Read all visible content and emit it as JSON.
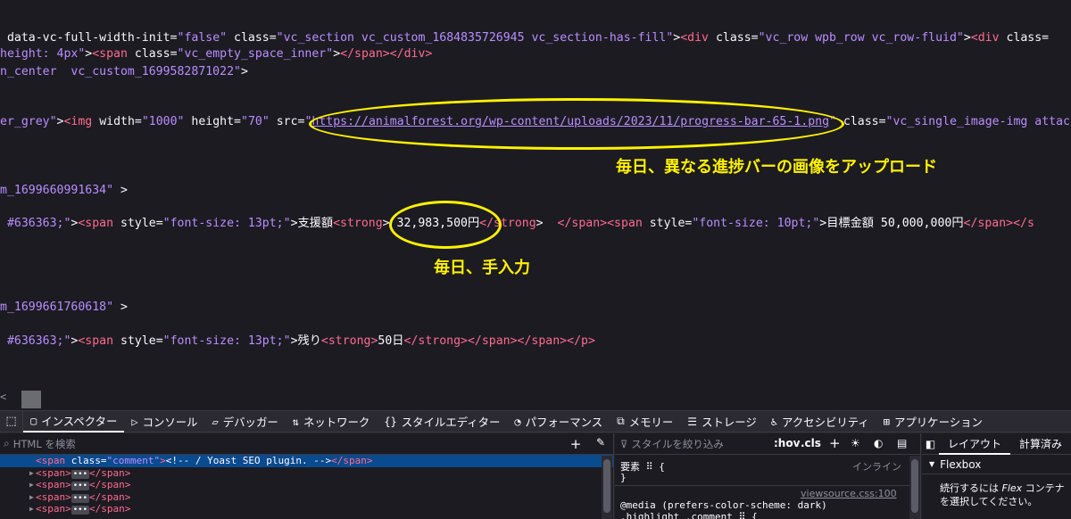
{
  "source": {
    "line1": {
      "p1": " data-vc-full-width-init=",
      "v1": "\"false\"",
      "a1": " class=",
      "v2": "\"vc_section vc_custom_1684835726945 vc_section-has-fill\"",
      "p2": ">",
      "t1": "<div",
      "a2": " class=",
      "v3": "\"vc_row wpb_row vc_row-fluid\"",
      "p3": ">",
      "t2": "<div",
      "a3": " class="
    },
    "line2": {
      "v1": "height: 4px\"",
      "p1": ">",
      "t1": "<span",
      "a1": " class=",
      "v2": "\"vc_empty_space_inner\"",
      "p2": ">",
      "t2": "</span>",
      "t3": "</div>"
    },
    "line3": {
      "v1": "n_center  vc_custom_1699582871022\"",
      "p1": ">"
    },
    "line4": {
      "v1": "er_grey\"",
      "p1": ">",
      "t1": "<img",
      "a1": " width=",
      "v2": "\"1000\"",
      "a2": " height=",
      "v3": "\"70\"",
      "a3": " src=",
      "q1": "\"",
      "link": "https://animalforest.org/wp-content/uploads/2023/11/progress-bar-65-1.png",
      "q2": "\"",
      "a4": " class=",
      "v4": "\"vc_single_image-img attac"
    },
    "line5": {
      "v1": "m_1699660991634\"",
      "p1": " >"
    },
    "line6": {
      "v1": " #636363;\"",
      "p1": ">",
      "t1": "<span",
      "a1": " style=",
      "v2": "\"font-size: 13pt;\"",
      "p2": ">",
      "x1": "支援額",
      "t2": "<strong",
      "p3": ">",
      "x2": " 32,983,500円",
      "t3": "</strong",
      "p4": ">  ",
      "t4": "</span>",
      "t5": "<span",
      "a2": " style=",
      "v3": "\"font-size: 10pt;\"",
      "p5": ">",
      "x3": "目標金額 50,000,000円",
      "t6": "</span>",
      "t7": "</s"
    },
    "line7": {
      "v1": "m_1699661760618\"",
      "p1": " >"
    },
    "line8": {
      "v1": " #636363;\"",
      "p1": ">",
      "t1": "<span",
      "a1": " style=",
      "v2": "\"font-size: 13pt;\"",
      "p2": ">",
      "x1": "残り",
      "t2": "<strong>",
      "x2": "50日",
      "t3": "</strong>",
      "t4": "</span>",
      "t5": "</span>",
      "t6": "</p>"
    },
    "scroll_left": "<"
  },
  "annotations": {
    "upload_note": "毎日、異なる進捗バーの画像をアップロード",
    "manual_note": "毎日、手入力",
    "color": "#fff200"
  },
  "devtools": {
    "tabs": [
      {
        "icon": "▢",
        "label": "インスペクター"
      },
      {
        "icon": "▷",
        "label": "コンソール"
      },
      {
        "icon": "▱",
        "label": "デバッガー"
      },
      {
        "icon": "⇅",
        "label": "ネットワーク"
      },
      {
        "icon": "{}",
        "label": "スタイルエディター"
      },
      {
        "icon": "◔",
        "label": "パフォーマンス"
      },
      {
        "icon": "⧉",
        "label": "メモリー"
      },
      {
        "icon": "☰",
        "label": "ストレージ"
      },
      {
        "icon": "♿",
        "label": "アクセシビリティ"
      },
      {
        "icon": "⊞",
        "label": "アプリケーション"
      }
    ],
    "html_search_placeholder": "HTML を検索",
    "tree": {
      "row1": {
        "t1": "<span",
        "a1": " class=",
        "v1": "\"comment\"",
        "p1": ">",
        "c1": "<!-- / Yoast SEO plugin. -->",
        "t2": "</span>"
      },
      "collapsed_open": "<span>",
      "collapsed_ellipsis": "•••",
      "collapsed_close": "</span>"
    },
    "styles_filter_placeholder": "スタイルを絞り込み",
    "hov": ":hov",
    "cls": ".cls",
    "rules": {
      "element_line": "要素 ⠿ {",
      "inline_label": "インライン",
      "close_brace": "}",
      "source_link": "viewsource.css:100",
      "media_line": "@media (prefers-color-scheme: dark)",
      "selector_line": ".highlight .comment ⠿ {"
    },
    "layout": {
      "tab_layout": "レイアウト",
      "tab_computed": "計算済み",
      "flexbox_label": "Flexbox",
      "msg_line1_a": "続行するには ",
      "msg_line1_em": "Flex",
      "msg_line1_b": " コンテナ",
      "msg_line2": "を選択してください。"
    }
  }
}
